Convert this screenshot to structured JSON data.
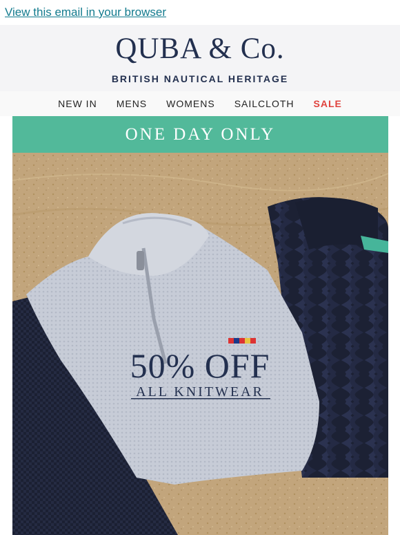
{
  "topbar": {
    "view_in_browser": "View this email in your browser"
  },
  "brand": {
    "name": "QUBA & Co.",
    "tagline": "BRITISH NAUTICAL HERITAGE"
  },
  "nav": {
    "items": [
      {
        "label": "NEW IN"
      },
      {
        "label": "MENS"
      },
      {
        "label": "WOMENS"
      },
      {
        "label": "SAILCLOTH"
      },
      {
        "label": "SALE"
      }
    ]
  },
  "banner": {
    "text": "ONE DAY ONLY"
  },
  "hero": {
    "headline": "50% OFF",
    "subline": "ALL KNITWEAR"
  },
  "colors": {
    "navy": "#23304f",
    "teal": "#52b99a",
    "sale_red": "#e0423d",
    "link": "#137b8e"
  }
}
